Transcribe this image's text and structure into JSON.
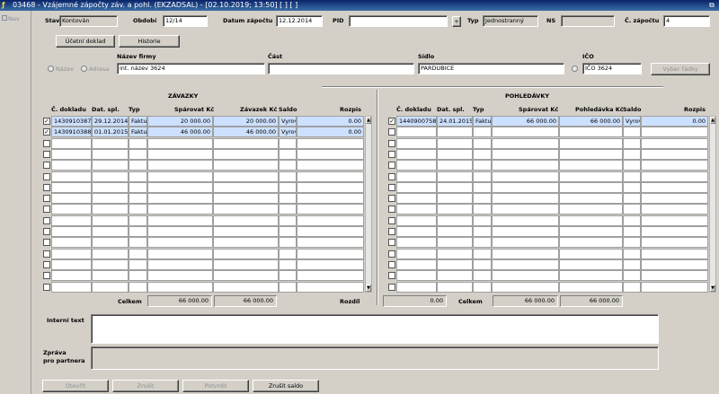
{
  "window": {
    "title": "03468 - Vzájemné zápočty záv. a pohl. (EKZADSAL) - [02.10.2019; 13:50] [ ] [ ]",
    "restore_icon": "restore-window-icon"
  },
  "sidebar": {
    "nav_label": "Nav"
  },
  "header": {
    "stav_label": "Stav",
    "stav_value": "Kontován",
    "obdobi_label": "Období",
    "obdobi_value": "12/14",
    "datum_label": "Datum zápočtu",
    "datum_value": "12.12.2014",
    "pid_label": "PID",
    "pid_value": "",
    "pid_plus": "+",
    "typ_label": "Typ",
    "typ_value": "Jednostranný",
    "ns_label": "NS",
    "ns_value": "",
    "cislo_label": "Č. zápočtu",
    "cislo_value": "4"
  },
  "buttons": {
    "ucetni_doklad": "Účetní doklad",
    "historie": "Historie",
    "vyber_radky": "Vyber řádky",
    "otevrit": "Otevřít",
    "zrusit": "Zrušit",
    "potvrdit": "Potvrdit",
    "zrusit_saldo": "Zrušit saldo"
  },
  "partner": {
    "radio_nazev": "Název",
    "radio_adresa": "Adresa",
    "nazev_label": "Název firmy",
    "nazev_value": "int. název 3624",
    "cast_label": "Část",
    "cast_value": "",
    "sidlo_label": "Sídlo",
    "sidlo_value": "PARDUBICE",
    "ico_label": "IČO",
    "ico_value": "IČO 3624"
  },
  "zavazky": {
    "title": "ZÁVAZKY",
    "columns": [
      "Č. dokladu",
      "Dat. spl.",
      "Typ",
      "Spárovat Kč",
      "Závazek Kč",
      "Saldo",
      "Rozpis"
    ],
    "rows": [
      {
        "checked": true,
        "doklad": "1430910387",
        "datum": "29.12.2014",
        "typ": "Faktu",
        "parovat": "20 000.00",
        "zavazek": "20 000.00",
        "saldo": "Vyrov",
        "rozpis": "0.00"
      },
      {
        "checked": true,
        "doklad": "1430910388",
        "datum": "01.01.2015",
        "typ": "Faktu",
        "parovat": "46 000.00",
        "zavazek": "46 000.00",
        "saldo": "Vyrov",
        "rozpis": "0.00"
      }
    ],
    "celkem_label": "Celkem",
    "celkem_parovat": "66 000.00",
    "celkem_zavazek": "66 000.00"
  },
  "pohledavky": {
    "title": "POHLEDÁVKY",
    "columns": [
      "Č. dokladu",
      "Dat. spl.",
      "Typ",
      "Spárovat Kč",
      "Pohledávka Kč",
      "Saldo",
      "Rozpis"
    ],
    "rows": [
      {
        "checked": true,
        "doklad": "1440900758",
        "datum": "24.01.2015",
        "typ": "Faktu",
        "parovat": "66 000.00",
        "pohledavka": "66 000.00",
        "saldo": "Vyrov",
        "rozpis": "0.00"
      }
    ],
    "celkem_label": "Celkem",
    "celkem_parovat": "66 000.00",
    "celkem_pohledavka": "66 000.00"
  },
  "rozdil": {
    "label": "Rozdíl",
    "value": "0.00"
  },
  "notes": {
    "interni_label": "Interní text",
    "interni_value": "",
    "zprava_label_1": "Zpráva",
    "zprava_label_2": "pro partnera",
    "zprava_value": ""
  }
}
